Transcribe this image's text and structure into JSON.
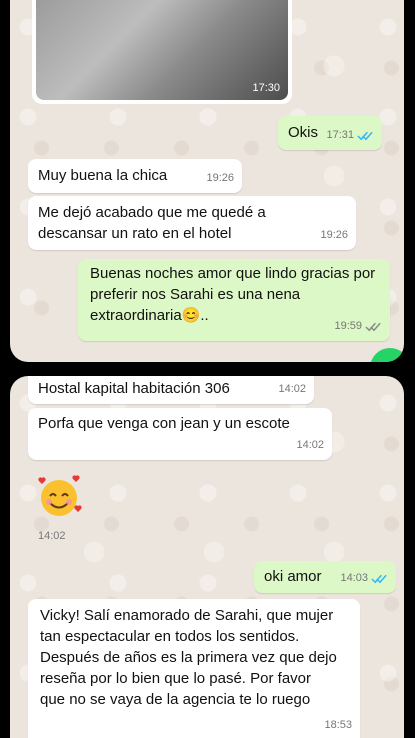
{
  "top_panel": {
    "media": {
      "time": "17:30"
    },
    "messages": [
      {
        "dir": "out",
        "text": "Okis",
        "time": "17:31",
        "ticks": "read"
      },
      {
        "dir": "in",
        "text": "Muy buena la chica",
        "time": "19:26"
      },
      {
        "dir": "in",
        "text": "Me dejó acabado que me quedé a descansar un rato en el hotel",
        "time": "19:26"
      },
      {
        "dir": "out",
        "text": "Buenas noches amor que lindo gracias por preferir nos Sarahi es una nena extraordinaria😊..",
        "time": "19:59",
        "ticks": "delivered"
      }
    ]
  },
  "bottom_panel": {
    "messages": [
      {
        "dir": "in",
        "text": "Hostal kapital habitación 306",
        "time": "14:02"
      },
      {
        "dir": "in",
        "text": "Porfa que venga con jean y un escote",
        "time": "14:02"
      },
      {
        "dir": "in",
        "emoji": "smiling-face-with-hearts",
        "time": "14:02"
      },
      {
        "dir": "out",
        "text": "oki amor",
        "time": "14:03",
        "ticks": "read"
      },
      {
        "dir": "in",
        "text": "Vicky! Salí enamorado de Sarahi, que mujer tan espectacular en todos los sentidos. Después de años es la primera vez que dejo reseña por lo bien que lo pasé. Por favor que no se vaya de la agencia te lo ruego",
        "time": "18:53"
      }
    ]
  },
  "colors": {
    "chat_background": "#ece5dd",
    "incoming_bubble": "#ffffff",
    "outgoing_bubble": "#dcf8c6",
    "read_ticks": "#34b7f1",
    "fab": "#25d366"
  }
}
